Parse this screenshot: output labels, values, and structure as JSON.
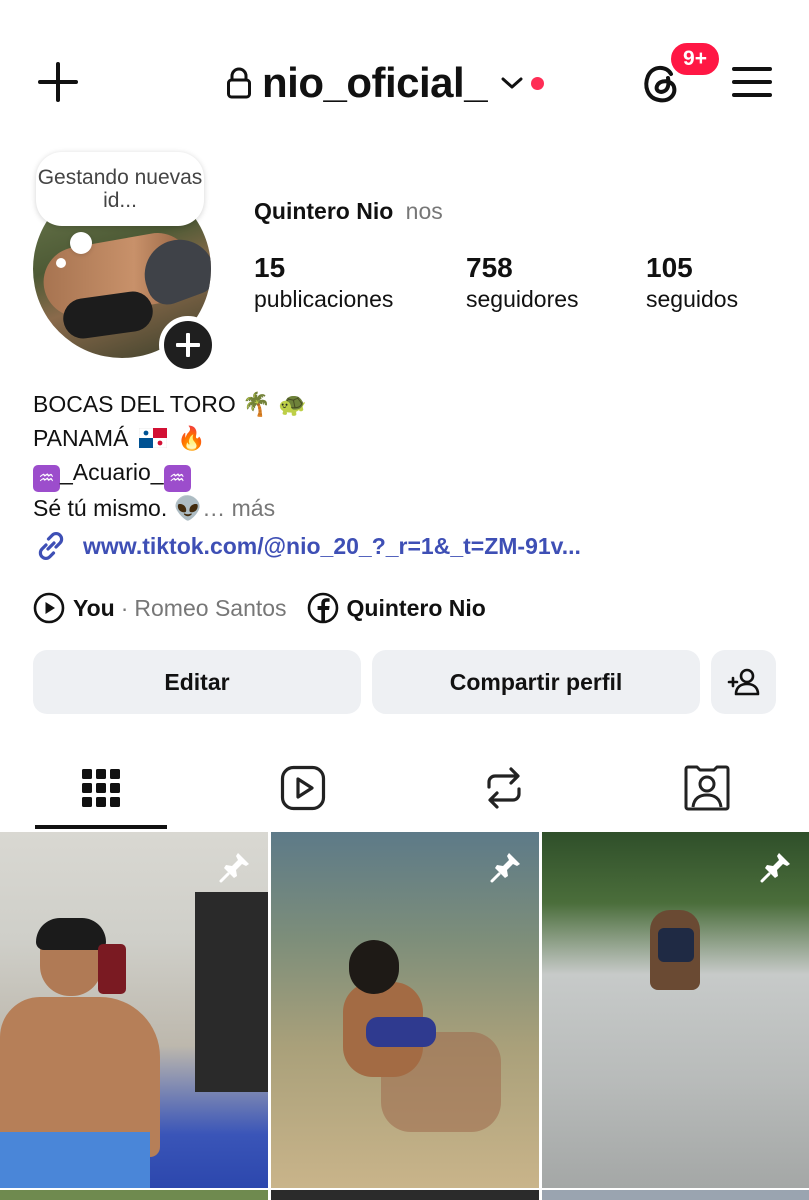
{
  "header": {
    "username": "nio_oficial_",
    "notification_badge": "9+"
  },
  "profile": {
    "note_bubble": "Gestando nuevas id...",
    "full_name": "Quintero Nio",
    "pronouns": "nos",
    "stats": [
      {
        "value": "15",
        "label": "publicaciones"
      },
      {
        "value": "758",
        "label": "seguidores"
      },
      {
        "value": "105",
        "label": "seguidos"
      }
    ],
    "bio": {
      "line1": "BOCAS DEL TORO",
      "line1_emoji": "🌴 🐢",
      "line2": "PANAMÁ",
      "line2_emoji": "🔥",
      "line3": "_Acuario_",
      "zodiac_glyph": "♒",
      "line4": "Sé tú mismo.",
      "line4_emoji": "👽",
      "more": "… más"
    },
    "link": "www.tiktok.com/@nio_20_?_r=1&_t=ZM-91v...",
    "music": {
      "song": "You",
      "separator": "·",
      "artist": "Romeo Santos"
    },
    "facebook": {
      "name": "Quintero Nio"
    }
  },
  "actions": {
    "edit_label": "Editar",
    "share_label": "Compartir perfil"
  },
  "tabs": [
    {
      "icon": "grid-icon",
      "active": true
    },
    {
      "icon": "reels-icon",
      "active": false
    },
    {
      "icon": "repost-icon",
      "active": false
    },
    {
      "icon": "tagged-icon",
      "active": false
    }
  ],
  "posts": [
    {
      "pinned": true,
      "icon": "pin-icon"
    },
    {
      "pinned": true,
      "icon": "pin-icon"
    },
    {
      "pinned": true,
      "icon": "pin-icon"
    }
  ],
  "colors": {
    "badge": "#ff1744",
    "link": "#3e4fb5",
    "button_bg": "#eef0f3",
    "muted": "#777777"
  }
}
